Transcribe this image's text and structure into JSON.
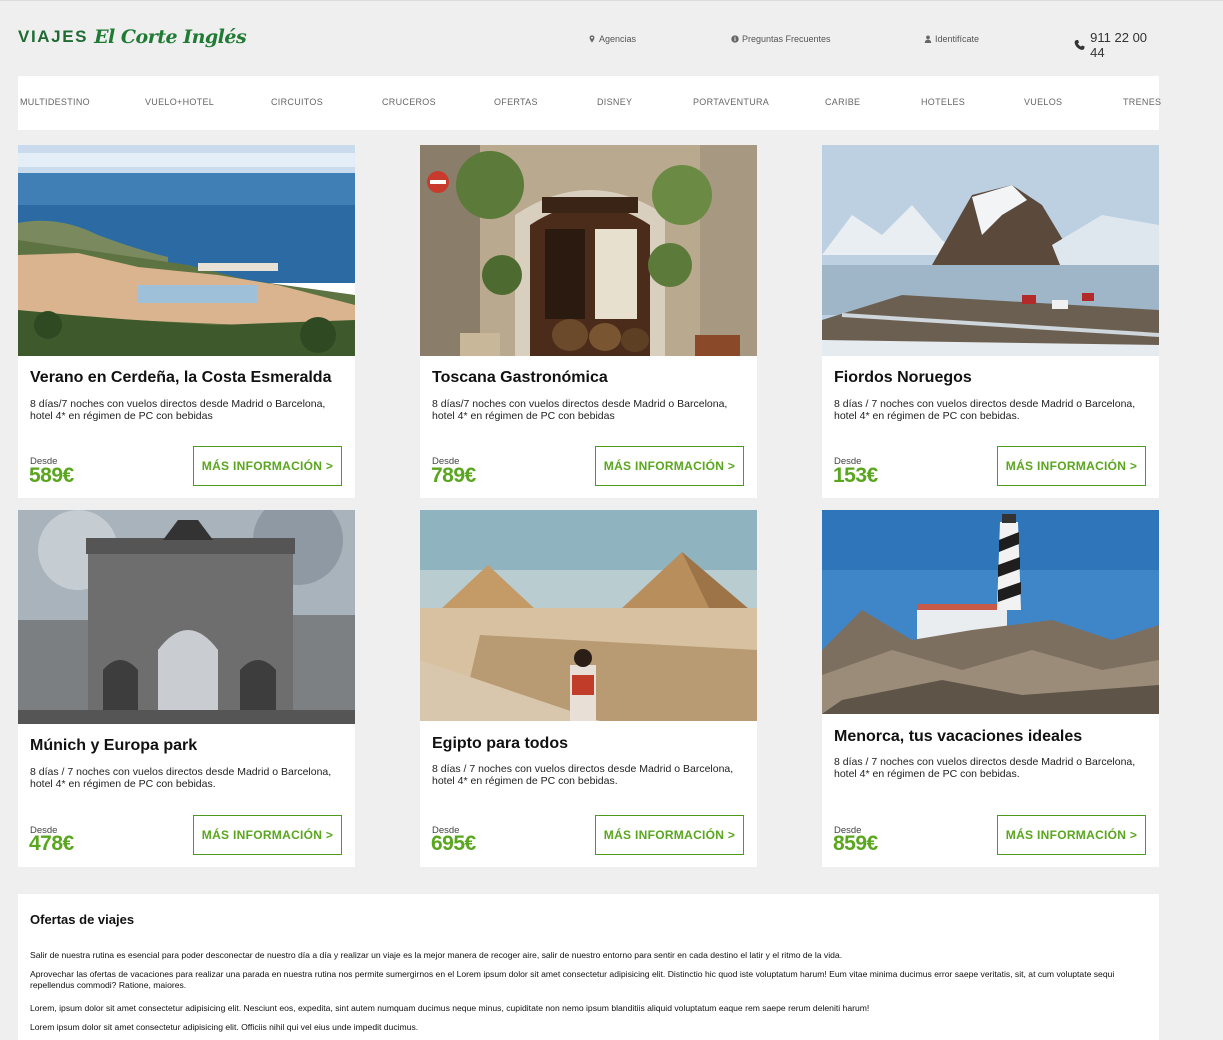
{
  "header": {
    "logo_viajes": "VIAJES",
    "logo_brand": "El Corte Inglés",
    "links": [
      {
        "label": "Agencias",
        "icon": "location-pin-icon"
      },
      {
        "label": "Preguntas Frecuentes",
        "icon": "info-icon"
      },
      {
        "label": "Identifícate",
        "icon": "user-icon"
      }
    ],
    "phone": "911 22 00 44"
  },
  "nav": {
    "items": [
      "MULTIDESTINO",
      "VUELO+HOTEL",
      "CIRCUITOS",
      "CRUCEROS",
      "OFERTAS",
      "DISNEY",
      "PORTAVENTURA",
      "CARIBE",
      "HOTELES",
      "VUELOS",
      "TRENES"
    ]
  },
  "cards": [
    {
      "title": "Verano en Cerdeña, la Costa Esmeralda",
      "desc": "8 días/7 noches con vuelos directos desde Madrid o Barcelona, hotel 4* en régimen de PC con bebidas",
      "from": "Desde",
      "price": "589€",
      "cta": "MÁS INFORMACIÓN >",
      "image": "sardinia-coast-photo"
    },
    {
      "title": "Toscana Gastronómica",
      "desc": "8 días/7 noches con vuelos directos desde Madrid o Barcelona, hotel 4* en régimen de PC con bebidas",
      "from": "Desde",
      "price": "789€",
      "cta": "MÁS INFORMACIÓN >",
      "image": "trattoria-photo"
    },
    {
      "title": "Fiordos Noruegos",
      "desc": "8 días / 7 noches con vuelos directos desde Madrid o Barcelona, hotel 4* en régimen de PC con bebidas.",
      "from": "Desde",
      "price": "153€",
      "cta": "MÁS INFORMACIÓN >",
      "image": "norway-fjord-photo"
    },
    {
      "title": "Múnich y Europa park",
      "desc": "8 días / 7 noches con vuelos directos desde Madrid o Barcelona, hotel 4* en régimen de PC con bebidas.",
      "from": "Desde",
      "price": "478€",
      "cta": "MÁS INFORMACIÓN >",
      "image": "munich-arch-photo"
    },
    {
      "title": "Egipto para todos",
      "desc": "8 días / 7 noches con vuelos directos desde Madrid o Barcelona, hotel 4* en régimen de PC con bebidas.",
      "from": "Desde",
      "price": "695€",
      "cta": "MÁS INFORMACIÓN >",
      "image": "egypt-pyramids-photo"
    },
    {
      "title": "Menorca, tus vacaciones ideales",
      "desc": "8 días / 7 noches con vuelos directos desde Madrid o Barcelona, hotel 4* en régimen de PC con bebidas.",
      "from": "Desde",
      "price": "859€",
      "cta": "MÁS INFORMACIÓN >",
      "image": "menorca-lighthouse-photo"
    }
  ],
  "info": {
    "title": "Ofertas de viajes",
    "paragraphs": [
      "Salir de nuestra rutina es esencial para poder desconectar de nuestro día a día y realizar un viaje es la mejor manera de recoger aire, salir de nuestro entorno para sentir en cada destino el latir y el ritmo de la vida.",
      "Aprovechar las ofertas de vacaciones para realizar una parada en nuestra rutina nos permite sumergirnos en el Lorem ipsum dolor sit amet consectetur adipisicing elit. Distinctio hic quod iste voluptatum harum! Eum vitae minima ducimus error saepe veritatis, sit, at cum voluptate sequi repellendus commodi? Ratione, maiores.",
      "Lorem, ipsum dolor sit amet consectetur adipisicing elit. Nesciunt eos, expedita, sint autem numquam ducimus neque minus, cupiditate non nemo ipsum blanditiis aliquid voluptatum eaque rem saepe rerum deleniti harum!",
      "Lorem ipsum dolor sit amet consectetur adipisicing elit. Officiis nihil qui vel eius unde impedit ducimus."
    ]
  }
}
